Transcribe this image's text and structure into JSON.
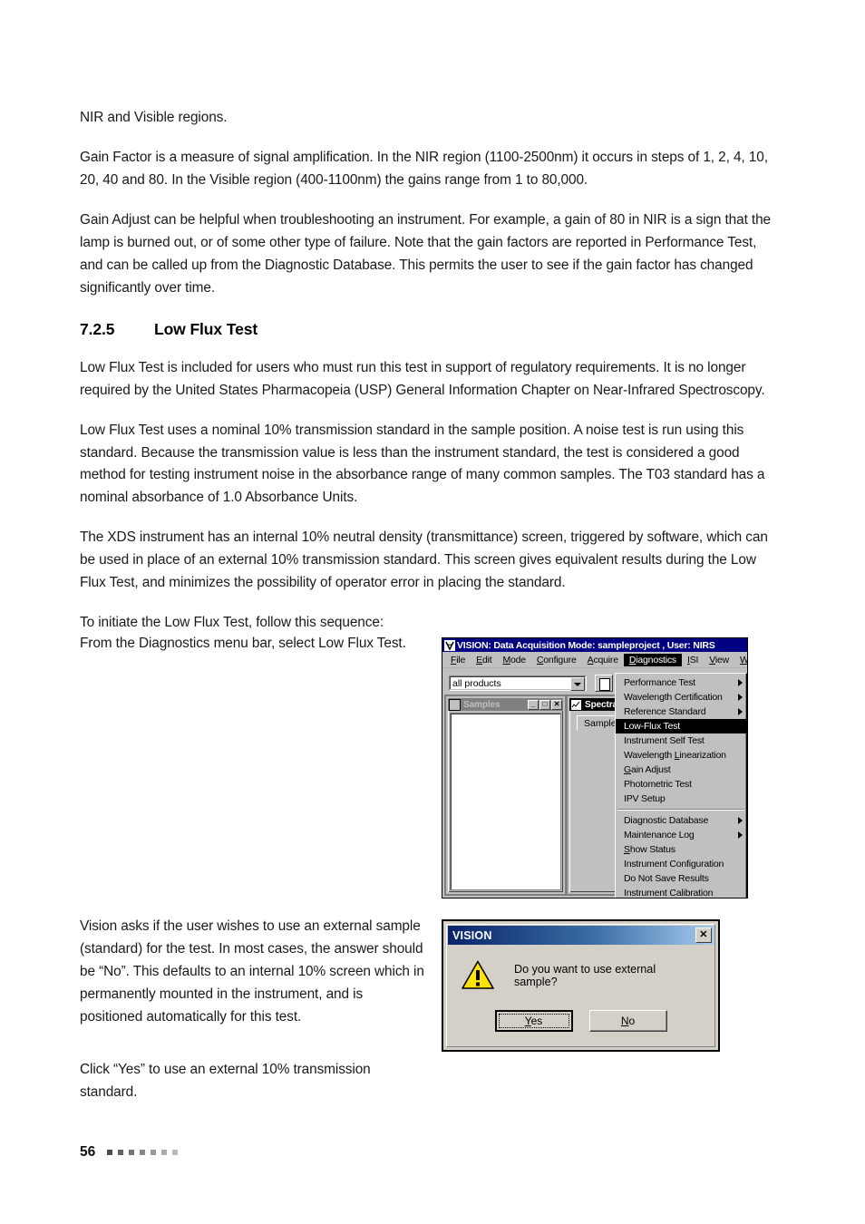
{
  "document": {
    "paragraphs_top": [
      "NIR and Visible regions.",
      "Gain Factor is a measure of signal amplification. In the NIR region (1100-2500nm) it occurs in steps of 1, 2, 4, 10, 20, 40 and 80. In the Visible region (400-1100nm) the gains range from 1 to 80,000.",
      "Gain Adjust can be helpful when troubleshooting an instrument. For example, a gain of 80 in NIR is a sign that the lamp is burned out, or of some other type of failure. Note that the gain factors are reported in Performance Test, and can be called up from the Diagnostic Database. This permits the user to see if the gain factor has changed significantly over time."
    ],
    "heading": {
      "number": "7.2.5",
      "title": "Low Flux Test"
    },
    "paragraphs_mid": [
      "Low Flux Test is included for users who must run this test in support of regulatory requirements. It is no longer required by the United States Pharmacopeia (USP) General Information Chapter on Near-Infrared Spectroscopy.",
      "Low Flux Test uses a nominal 10% transmission standard in the sample position. A noise test is run using this standard. Because the transmission value is less than the instrument standard, the test is considered a good method for testing instrument noise in the absorbance range of many common samples. The T03 standard has a nominal absorbance of 1.0 Absorbance Units.",
      "The XDS instrument has an internal 10% neutral density (transmittance) screen, triggered by software, which can be used in place of an external 10% transmission standard. This screen gives equivalent results during the Low Flux Test, and minimizes the possibility of operator error in placing the standard.",
      "To initiate the Low Flux Test, follow this sequence:"
    ],
    "caption_menu": "From the Diagnostics menu bar, select Low Flux Test.",
    "caption_dialog": "Vision asks if the user wishes to use an external sample (standard) for the test. In most cases, the answer should be “No”. This defaults to an internal 10% screen which in permanently mounted in the instrument, and is positioned automatically for this test.",
    "caption_click_yes": "Click “Yes” to use an external 10% transmission standard.",
    "footer": {
      "page_number": "56",
      "dot_count": 7,
      "dot_colors": [
        "#4d4d4d",
        "#626262",
        "#757575",
        "#888888",
        "#9a9a9a",
        "#ababab",
        "#bbbbbb"
      ]
    }
  },
  "app_window": {
    "title": "VISION: Data Acquisition Mode: sampleproject , User: NIRS",
    "logo_icon": "vision-logo-icon",
    "menubar": [
      {
        "label": "File",
        "mnemonic": "F",
        "active": false
      },
      {
        "label": "Edit",
        "mnemonic": "E",
        "active": false
      },
      {
        "label": "Mode",
        "mnemonic": "M",
        "active": false
      },
      {
        "label": "Configure",
        "mnemonic": "C",
        "active": false
      },
      {
        "label": "Acquire",
        "mnemonic": "A",
        "active": false
      },
      {
        "label": "Diagnostics",
        "mnemonic": "D",
        "active": true
      },
      {
        "label": "ISI",
        "mnemonic": "I",
        "active": false
      },
      {
        "label": "View",
        "mnemonic": "V",
        "active": false
      },
      {
        "label": "Wind",
        "mnemonic": "W",
        "active": false
      }
    ],
    "toolbar": {
      "product_filter_value": "all products",
      "new_button_icon": "new-document-icon",
      "dropdown_icon": "chevron-down-icon"
    },
    "child_windows": {
      "samples": {
        "title": "Samples",
        "icon": "samples-icon",
        "minimize": "_",
        "maximize": "□",
        "close": "✕"
      },
      "spectra": {
        "title": "Spectra",
        "icon": "spectra-chart-icon",
        "tab": "Sample"
      }
    },
    "diagnostics_menu": [
      {
        "label": "Performance Test",
        "submenu": true,
        "selected": false,
        "mnemonic": ""
      },
      {
        "label": "Wavelength Certification",
        "submenu": true,
        "selected": false,
        "mnemonic": "g"
      },
      {
        "label": "Reference Standard",
        "submenu": true,
        "selected": false,
        "mnemonic": ""
      },
      {
        "label": "Low-Flux Test",
        "submenu": false,
        "selected": true,
        "mnemonic": ""
      },
      {
        "label": "Instrument Self Test",
        "submenu": false,
        "selected": false,
        "mnemonic": ""
      },
      {
        "label": "Wavelength Linearization",
        "submenu": false,
        "selected": false,
        "mnemonic": "L"
      },
      {
        "label": "Gain Adjust",
        "submenu": false,
        "selected": false,
        "mnemonic": "G"
      },
      {
        "label": "Photometric Test",
        "submenu": false,
        "selected": false,
        "mnemonic": ""
      },
      {
        "label": "IPV Setup",
        "submenu": false,
        "selected": false,
        "mnemonic": ""
      },
      {
        "separator": true
      },
      {
        "label": "Diagnostic Database",
        "submenu": true,
        "selected": false,
        "mnemonic": ""
      },
      {
        "label": "Maintenance Log",
        "submenu": true,
        "selected": false,
        "mnemonic": "g"
      },
      {
        "label": "Show Status",
        "submenu": false,
        "selected": false,
        "mnemonic": "S"
      },
      {
        "label": "Instrument Configuration",
        "submenu": false,
        "selected": false,
        "mnemonic": ""
      },
      {
        "label": "Do Not Save Results",
        "submenu": false,
        "selected": false,
        "mnemonic": ""
      },
      {
        "label": "Instrument Calibration",
        "submenu": false,
        "selected": false,
        "mnemonic": ""
      }
    ]
  },
  "dialog": {
    "title": "VISION",
    "close_label": "✕",
    "icon": "warning-triangle-icon",
    "message": "Do you want to use external sample?",
    "buttons": [
      {
        "label": "Yes",
        "mnemonic": "Y",
        "default": true
      },
      {
        "label": "No",
        "mnemonic": "N",
        "default": false
      }
    ],
    "colors": {
      "titlebar_start": "#0a246a",
      "titlebar_end": "#a6caf0",
      "face": "#d4d0c8",
      "warning_yellow": "#ffe400"
    }
  }
}
